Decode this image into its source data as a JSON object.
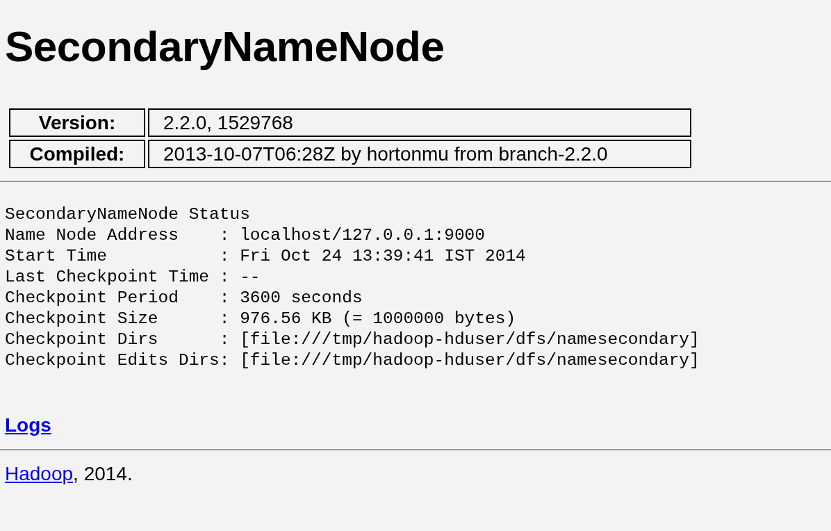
{
  "title": "SecondaryNameNode",
  "info_table": [
    {
      "label": "Version:",
      "value": "2.2.0, 1529768"
    },
    {
      "label": "Compiled:",
      "value": "2013-10-07T06:28Z by hortonmu from branch-2.2.0"
    }
  ],
  "status_lines": [
    "SecondaryNameNode Status",
    "Name Node Address    : localhost/127.0.0.1:9000",
    "Start Time           : Fri Oct 24 13:39:41 IST 2014",
    "Last Checkpoint Time : --",
    "Checkpoint Period    : 3600 seconds",
    "Checkpoint Size      : 976.56 KB (= 1000000 bytes)",
    "Checkpoint Dirs      : [file:///tmp/hadoop-hduser/dfs/namesecondary]",
    "Checkpoint Edits Dirs: [file:///tmp/hadoop-hduser/dfs/namesecondary]"
  ],
  "logs_link": "Logs",
  "footer": {
    "link": "Hadoop",
    "text": ", 2014."
  }
}
